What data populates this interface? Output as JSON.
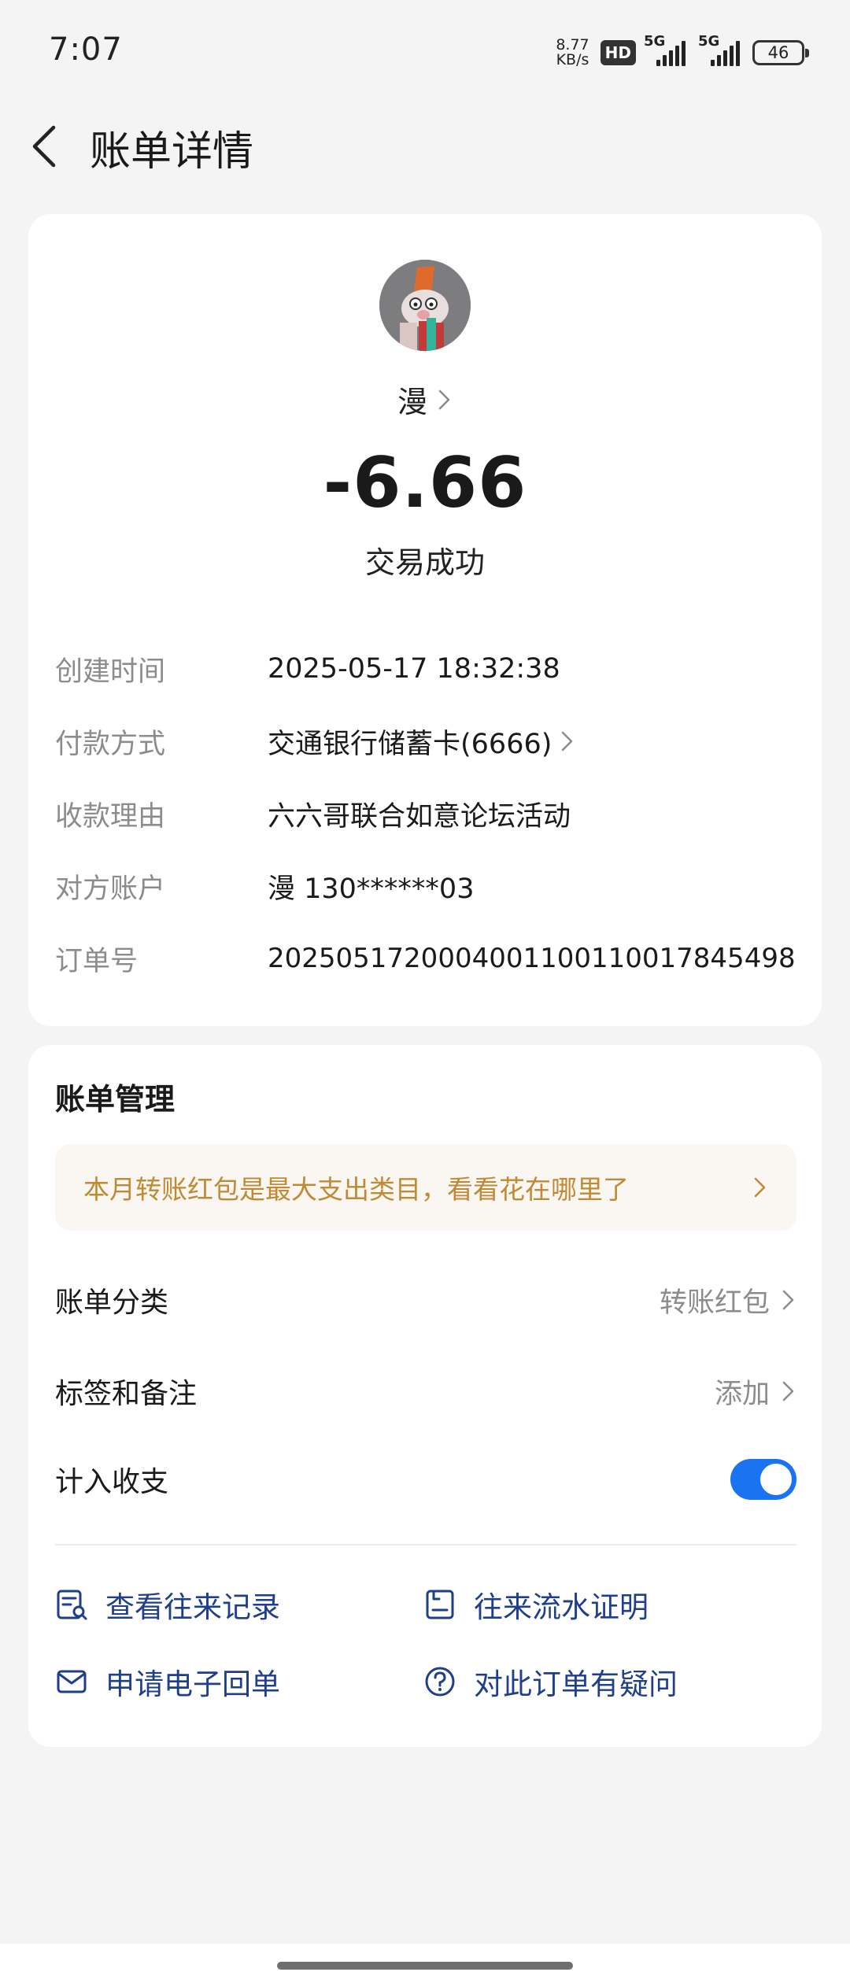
{
  "status_bar": {
    "time": "7:07",
    "net_speed_value": "8.77",
    "net_speed_unit": "KB/s",
    "hd_label": "HD",
    "sim1_label": "5G",
    "sim2_label": "5G",
    "battery": "46"
  },
  "header": {
    "title": "账单详情",
    "back_icon": "chevron-left-icon"
  },
  "transaction": {
    "payee_name": "漫",
    "amount": "-6.66",
    "status": "交易成功"
  },
  "details": [
    {
      "label": "创建时间",
      "value": "2025-05-17 18:32:38"
    },
    {
      "label": "付款方式",
      "value": "交通银行储蓄卡(6666)"
    },
    {
      "label": "收款理由",
      "value": "六六哥联合如意论坛活动"
    },
    {
      "label": "对方账户",
      "value": "漫 130******03"
    },
    {
      "label": "订单号",
      "value": "2025051720004001100110017845498"
    }
  ],
  "manage": {
    "title": "账单管理",
    "promo": "本月转账红包是最大支出类目，看看花在哪里了",
    "category_label": "账单分类",
    "category_value": "转账红包",
    "tags_label": "标签和备注",
    "tags_value": "添加",
    "include_label": "计入收支",
    "include_enabled": true,
    "actions": [
      {
        "label": "查看往来记录",
        "icon": "record-search-icon"
      },
      {
        "label": "往来流水证明",
        "icon": "statement-icon"
      },
      {
        "label": "申请电子回单",
        "icon": "mail-icon"
      },
      {
        "label": "对此订单有疑问",
        "icon": "question-icon"
      }
    ]
  },
  "colors": {
    "background": "#f4f4f4",
    "card": "#ffffff",
    "promo_bg": "#faf6f1",
    "promo_text": "#c08a35",
    "action_text": "#1f3f8a",
    "toggle_on": "#1a73f0"
  }
}
